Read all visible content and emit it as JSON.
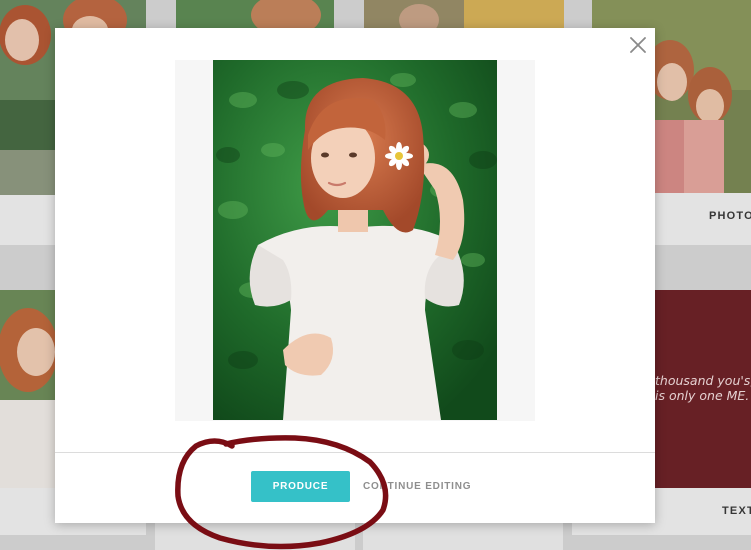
{
  "gallery": {
    "tiles": [
      {
        "label": ""
      },
      {
        "label": ""
      },
      {
        "label": ""
      },
      {
        "label": "PHOTO"
      },
      {
        "label": ""
      },
      {
        "label": "TEXT"
      }
    ],
    "quote_text": "thousand you's,\nis only one ME."
  },
  "modal": {
    "preview_alt": "Girl with red hair holding a daisy, white dress, green foliage background",
    "produce_label": "PRODUCE",
    "continue_label": "CONTINUE EDITING"
  },
  "colors": {
    "accent": "#35c1c8",
    "annotation": "#7a0d14",
    "quote_tile": "#6e2228"
  },
  "icons": {
    "close": "close-icon"
  }
}
